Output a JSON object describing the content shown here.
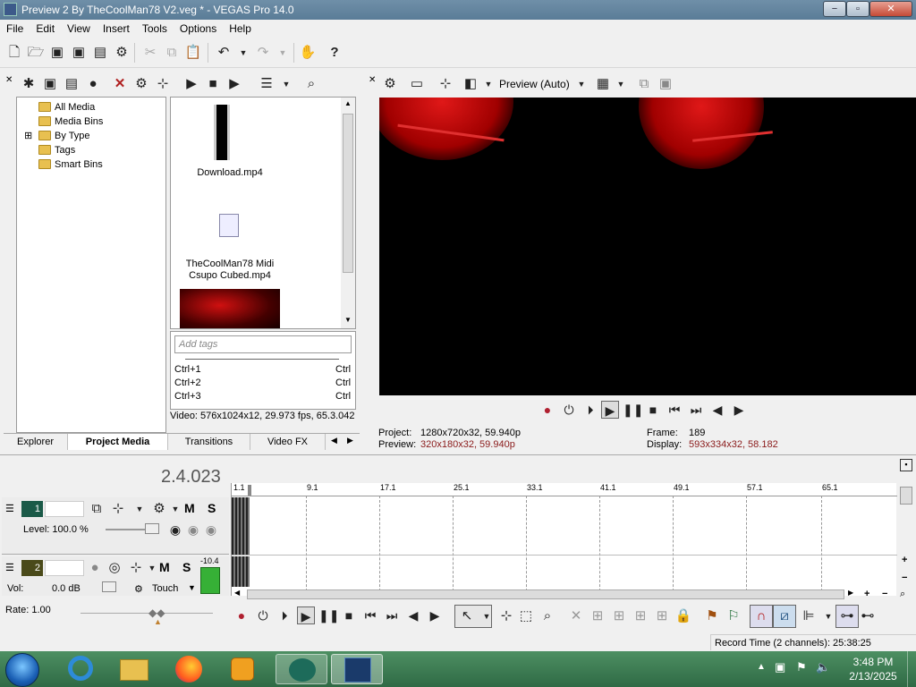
{
  "window": {
    "title": "Preview 2 By TheCoolMan78 V2.veg * - VEGAS Pro 14.0",
    "min": "−",
    "max": "▫",
    "close": "✕"
  },
  "menu": [
    "File",
    "Edit",
    "View",
    "Insert",
    "Tools",
    "Options",
    "Help"
  ],
  "explorer": {
    "tree": [
      "All Media",
      "Media Bins",
      "By Type",
      "Tags",
      "Smart Bins"
    ],
    "expander": "⊞"
  },
  "media": {
    "items": [
      "Download.mp4",
      "TheCoolMan78 Midi Csupo Cubed.mp4"
    ],
    "tags_placeholder": "Add tags",
    "shortcuts": [
      {
        "key": "Ctrl+1",
        "right": "Ctrl"
      },
      {
        "key": "Ctrl+2",
        "right": "Ctrl"
      },
      {
        "key": "Ctrl+3",
        "right": "Ctrl"
      }
    ],
    "info": "Video: 576x1024x12, 29.973 fps, 65.3.042"
  },
  "tabs": [
    "Explorer",
    "Project Media",
    "Transitions",
    "Video FX"
  ],
  "preview": {
    "mode": "Preview (Auto)",
    "project_label": "Project:",
    "project_value": "1280x720x32, 59.940p",
    "preview_label": "Preview:",
    "preview_value": "320x180x32, 59.940p",
    "frame_label": "Frame:",
    "frame_value": "189",
    "display_label": "Display:",
    "display_value": "593x334x32, 58.182"
  },
  "timeline": {
    "time": "2.4.023",
    "ruler": [
      "1.1",
      "9.1",
      "17.1",
      "25.1",
      "33.1",
      "41.1",
      "49.1",
      "57.1",
      "65.1"
    ],
    "track1": {
      "num": "1",
      "level": "Level: 100.0 %",
      "m": "M",
      "s": "S"
    },
    "track2": {
      "num": "2",
      "vol": "Vol:",
      "vol_value": "0.0 dB",
      "touch": "Touch",
      "m": "M",
      "s": "S",
      "meter": "-10.4"
    }
  },
  "bottom": {
    "rate": "Rate: 1.00",
    "record_time": "Record Time (2 channels): 25:38:25"
  },
  "taskbar": {
    "time": "3:48 PM",
    "date": "2/13/2025"
  },
  "colors": {
    "accent_red": "#9a2020",
    "meter_green": "#36b036"
  }
}
